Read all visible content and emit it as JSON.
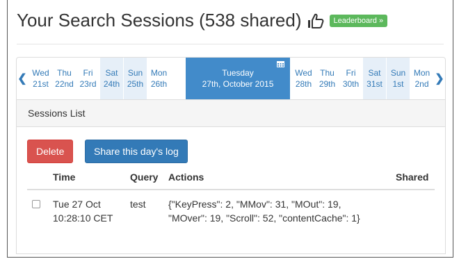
{
  "header": {
    "title": "Your Search Sessions (538 shared)",
    "leaderboard_label": "Leaderboard »"
  },
  "date_nav": {
    "days": [
      {
        "dow": "Wed",
        "date": "21st",
        "weekend": false
      },
      {
        "dow": "Thu",
        "date": "22nd",
        "weekend": false
      },
      {
        "dow": "Fri",
        "date": "23rd",
        "weekend": false
      },
      {
        "dow": "Sat",
        "date": "24th",
        "weekend": true
      },
      {
        "dow": "Sun",
        "date": "25th",
        "weekend": true
      },
      {
        "dow": "Mon",
        "date": "26th",
        "weekend": false
      }
    ],
    "selected": {
      "dow": "Tuesday",
      "date": "27th, October 2015"
    },
    "days_after": [
      {
        "dow": "Wed",
        "date": "28th",
        "weekend": false
      },
      {
        "dow": "Thu",
        "date": "29th",
        "weekend": false
      },
      {
        "dow": "Fri",
        "date": "30th",
        "weekend": false
      },
      {
        "dow": "Sat",
        "date": "31st",
        "weekend": true
      },
      {
        "dow": "Sun",
        "date": "1st",
        "weekend": true
      },
      {
        "dow": "Mon",
        "date": "2nd",
        "weekend": false
      }
    ]
  },
  "panel": {
    "heading": "Sessions List",
    "delete_label": "Delete",
    "share_label": "Share this day's log",
    "columns": {
      "time": "Time",
      "query": "Query",
      "actions": "Actions",
      "shared": "Shared"
    },
    "rows": [
      {
        "time_line1": "Tue 27 Oct",
        "time_line2": "10:28:10 CET",
        "query": "test",
        "actions_line1": "{\"KeyPress\": 2, \"MMov\": 31, \"MOut\": 19,",
        "actions_line2": "\"MOver\": 19, \"Scroll\": 52, \"contentCache\": 1}",
        "shared": ""
      }
    ]
  },
  "colors": {
    "accent": "#428bca",
    "link": "#337ab7",
    "weekend_bg": "#e6eff8",
    "delete": "#d9534f",
    "leaderboard": "#5cb85c"
  },
  "icons": {
    "thumb": "thumbs-up-icon",
    "calendar": "calendar-icon",
    "prev": "chevron-left-icon",
    "next": "chevron-right-icon"
  }
}
